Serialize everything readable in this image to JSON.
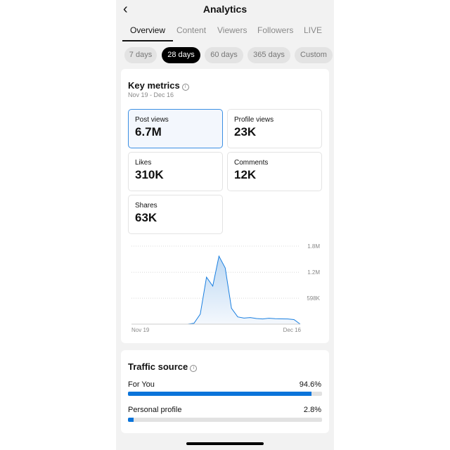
{
  "header": {
    "title": "Analytics",
    "back_icon": "chevron-left-icon"
  },
  "tabs": [
    {
      "label": "Overview",
      "active": true
    },
    {
      "label": "Content"
    },
    {
      "label": "Viewers"
    },
    {
      "label": "Followers"
    },
    {
      "label": "LIVE"
    }
  ],
  "ranges": [
    {
      "label": "7 days"
    },
    {
      "label": "28 days",
      "active": true
    },
    {
      "label": "60 days"
    },
    {
      "label": "365 days"
    },
    {
      "label": "Custom"
    }
  ],
  "key_metrics": {
    "title": "Key metrics",
    "info_icon": "i",
    "date_range": "Nov 19 - Dec 16",
    "items": [
      {
        "label": "Post views",
        "value": "6.7M",
        "selected": true
      },
      {
        "label": "Profile views",
        "value": "23K"
      },
      {
        "label": "Likes",
        "value": "310K"
      },
      {
        "label": "Comments",
        "value": "12K"
      },
      {
        "label": "Shares",
        "value": "63K"
      }
    ]
  },
  "chart_data": {
    "type": "area",
    "x_labels": [
      "Nov 19",
      "Dec 16"
    ],
    "y_ticks": [
      {
        "value": 1800000,
        "label": "1.8M"
      },
      {
        "value": 1196000,
        "label": "1.2M"
      },
      {
        "value": 598000,
        "label": "598K"
      }
    ],
    "ylim": [
      0,
      1800000
    ],
    "grid": "horizontal dotted",
    "color": "#1a7fe0",
    "values": [
      null,
      null,
      null,
      null,
      null,
      null,
      0,
      0,
      0,
      0,
      20000,
      231000,
      1083000,
      877000,
      1568000,
      1298000,
      367000,
      167000,
      140000,
      153000,
      130000,
      120000,
      137000,
      125000,
      122000,
      120000,
      105000,
      0
    ]
  },
  "traffic": {
    "title": "Traffic source",
    "info_icon": "i",
    "items": [
      {
        "label": "For You",
        "value": "94.6%",
        "pct": 94.6
      },
      {
        "label": "Personal profile",
        "value": "2.8%",
        "pct": 2.8
      }
    ]
  }
}
